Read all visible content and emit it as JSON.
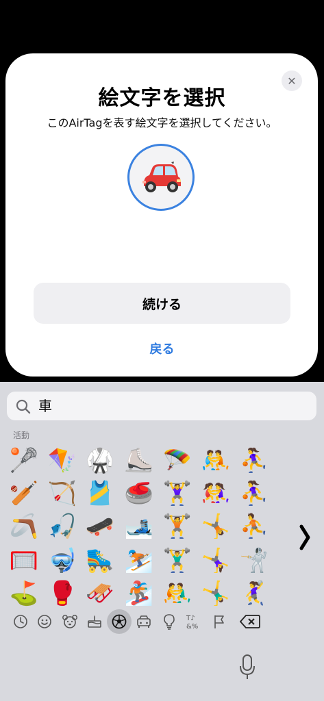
{
  "dialog": {
    "title": "絵文字を選択",
    "subtitle": "このAirTagを表す絵文字を選択してください。",
    "selected_emoji": "🚗",
    "continue_label": "続ける",
    "back_label": "戻る",
    "close_icon": "close-icon",
    "accent_color": "#2f7be0"
  },
  "keyboard": {
    "search_query": "車",
    "category_label": "活動",
    "emojis": [
      [
        "🥍",
        "🪁",
        "🥋",
        "⛸️",
        "🪂",
        "🤼",
        "⛹️‍♀️"
      ],
      [
        "🏏",
        "🏹",
        "🎽",
        "🥌",
        "🏋️‍♀️",
        "🤼‍♀️",
        "⛹️‍♀️"
      ],
      [
        "🪃",
        "🎣",
        "🛹",
        "🎿",
        "🏋️",
        "🤸",
        "⛹️"
      ],
      [
        "🥅",
        "🤿",
        "🛼",
        "⛷️",
        "🏋️‍♂️",
        "🤸‍♀️",
        "🤺"
      ],
      [
        "⛳",
        "🥊",
        "🛷",
        "🏂",
        "🤼‍♂️",
        "🤸‍♂️",
        "🤾‍♀️"
      ]
    ],
    "tabs": [
      {
        "name": "recent-icon",
        "active": false
      },
      {
        "name": "smiley-icon",
        "active": false
      },
      {
        "name": "animal-icon",
        "active": false
      },
      {
        "name": "food-icon",
        "active": false
      },
      {
        "name": "activity-icon",
        "active": true
      },
      {
        "name": "travel-icon",
        "active": false
      },
      {
        "name": "objects-icon",
        "active": false
      },
      {
        "name": "symbols-icon",
        "active": false
      },
      {
        "name": "flag-icon",
        "active": false
      },
      {
        "name": "delete-icon",
        "active": false
      }
    ]
  }
}
